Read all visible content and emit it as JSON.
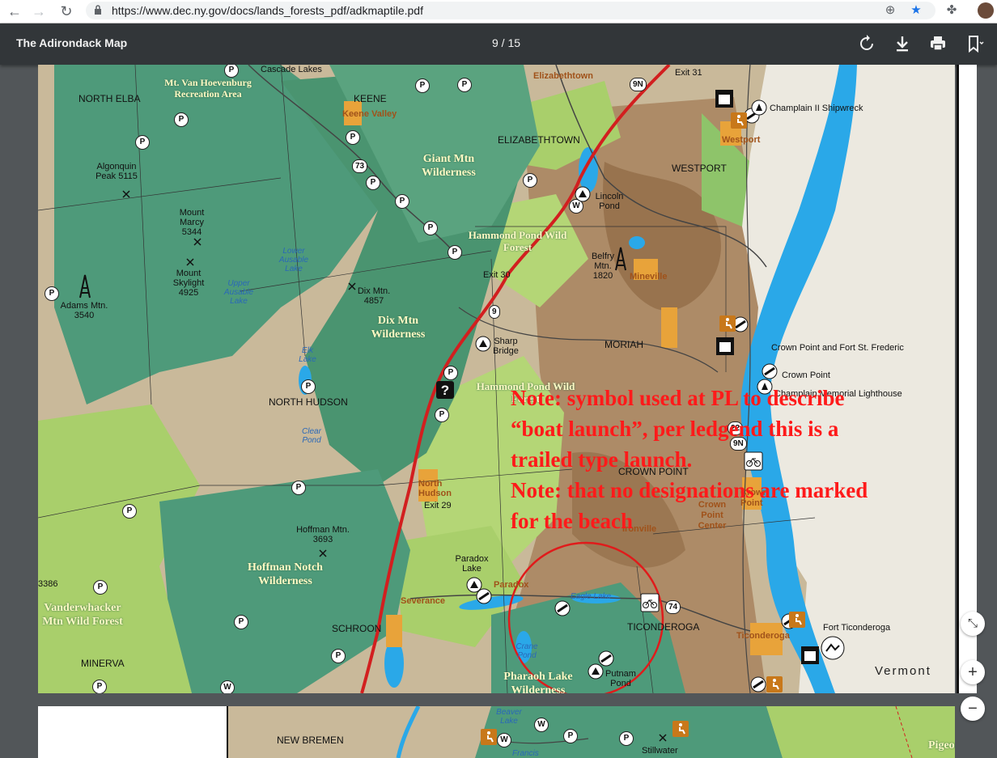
{
  "browser": {
    "url": "https://www.dec.ny.gov/docs/lands_forests_pdf/adkmaptile.pdf",
    "back_icon": "back-arrow-icon",
    "forward_icon": "forward-arrow-icon",
    "reload_icon": "reload-icon"
  },
  "viewer": {
    "title": "The Adirondack Map",
    "page_indicator": "9 / 15",
    "rotate_icon": "rotate-icon",
    "download_icon": "download-icon",
    "print_icon": "print-icon",
    "bookmark_icon": "bookmark-icon"
  },
  "zoom": {
    "fit": "⤡",
    "in": "+",
    "out": "−"
  },
  "map": {
    "towns": [
      "NORTH ELBA",
      "KEENE",
      "ELIZABETHTOWN",
      "WESTPORT",
      "MORIAH",
      "NORTH HUDSON",
      "CROWN POINT",
      "TICONDEROGA",
      "SCHROON",
      "MINERVA"
    ],
    "hamlets": [
      "Keene Valley",
      "Westport",
      "Mineville",
      "North Hudson",
      "Paradox",
      "Severance",
      "Ironville",
      "Ticonderoga",
      "Crown Point",
      "Elizabethtown"
    ],
    "wilderness": [
      "Mt. Van Hoevenburg Recreation Area",
      "Giant Mtn Wilderness",
      "Hammond Pond Wild Forest",
      "Dix Mtn Wilderness",
      "Hammond Pond Wild Forest",
      "Hoffman Notch Wilderness",
      "Pharaoh Lake Wilderness",
      "Vanderwhacker Mtn Wild Forest"
    ],
    "places": {
      "algonquin": "Algonquin Peak 5115",
      "marcy": "Mount Marcy 5344",
      "skylight": "Mount Skylight 4925",
      "adams": "Adams Mtn. 3540",
      "dix": "Dix Mtn. 4857",
      "belfry": "Belfry Mtn. 1820",
      "hoffman": "Hoffman Mtn. 3693",
      "lincoln": "Lincoln Pond",
      "sharp": "Sharp Bridge",
      "paradox_lake": "Paradox Lake",
      "putnam": "Putnam Pond",
      "cascade": "Cascade Lakes",
      "vdw": "3386"
    },
    "waters": [
      "Lower Ausable Lake",
      "Upper Ausable Lake",
      "Elk Lake",
      "Clear Pond",
      "Eagle Lake",
      "Crane Pond"
    ],
    "landmarks": {
      "shipwreck": "Champlain II Shipwreck",
      "fort_crown": "Crown Point and Fort St. Frederic",
      "crown_point": "Crown Point",
      "lighthouse": "Champlain Memorial Lighthouse",
      "fort_ti": "Fort Ticonderoga",
      "crown_center": "Crown Point Center"
    },
    "routes": [
      "9N",
      "Exit 31",
      "73",
      "Exit 30",
      "9",
      "22",
      "9N",
      "Exit 29",
      "74"
    ],
    "state": "Vermont",
    "annotation": [
      "Note: symbol used at PL to describe",
      "“boat launch”, per ledgend this is a",
      "trailed type launch.",
      "Note: that no designations are marked",
      "for the beach"
    ],
    "page2": {
      "towns": [
        "NEW BREMEN"
      ],
      "places": [
        "Beaver Lake",
        "Stillwater",
        "Pigeon",
        "Francis"
      ]
    }
  },
  "colors": {
    "forest": "#4e9a7a",
    "wildforest": "#a9cf6b",
    "private": "#c9b99a",
    "water": "#2aa8e8",
    "highway": "#d21f1f",
    "annotation": "#ff1a1a"
  }
}
